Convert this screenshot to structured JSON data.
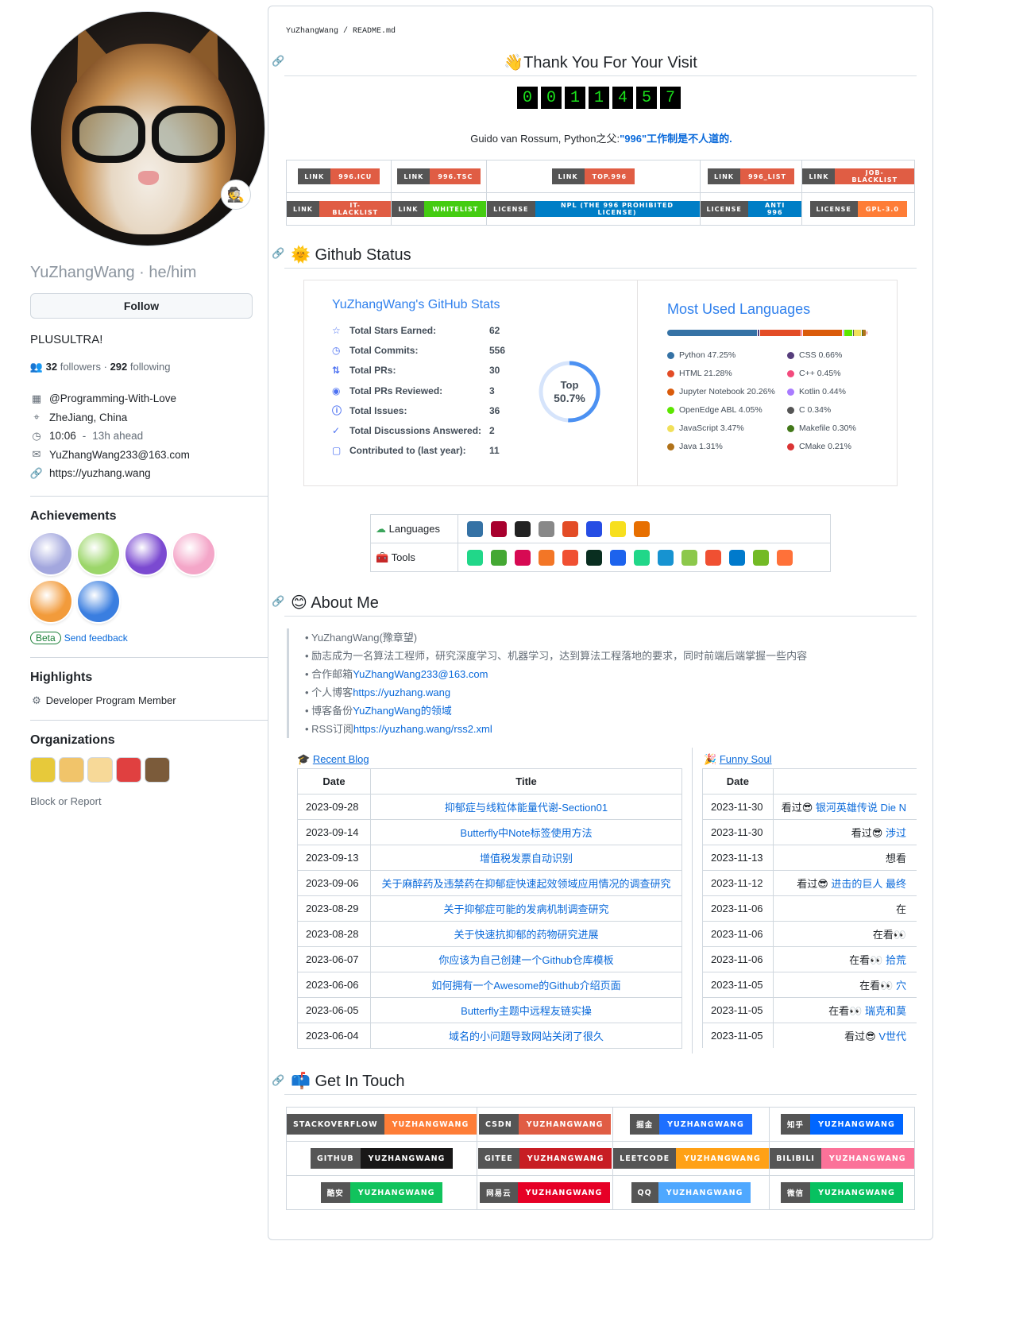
{
  "profile": {
    "username": "YuZhangWang",
    "pronouns": "he/him",
    "follow_label": "Follow",
    "bio": "PLUSULTRA!",
    "followers": "32",
    "followers_label": "followers",
    "following": "292",
    "following_label": "following",
    "status_emoji": "🕵️",
    "org": "@Programming-With-Love",
    "location": "ZheJiang, China",
    "time": "10:06",
    "time_offset": "13h ahead",
    "email": "YuZhangWang233@163.com",
    "website": "https://yuzhang.wang"
  },
  "achievements": {
    "title": "Achievements",
    "beta": "Beta",
    "feedback": "Send feedback",
    "colors": [
      "#a3a7de",
      "#9cd66a",
      "#7b4ad1",
      "#f4a6c8",
      "#f29b3b",
      "#3a7ee0"
    ]
  },
  "highlights": {
    "title": "Highlights",
    "item": "Developer Program Member"
  },
  "organizations": {
    "title": "Organizations",
    "block": "Block or Report",
    "colors": [
      "#e7c93a",
      "#f1c46a",
      "#f7d998",
      "#e04040",
      "#7b5b3a"
    ]
  },
  "readme": {
    "path_user": "YuZhangWang",
    "path_sep": " / ",
    "path_file": "README",
    "path_ext": ".md",
    "title_emoji": "👋",
    "title": "Thank You For Your Visit",
    "counter": [
      "0",
      "0",
      "1",
      "1",
      "4",
      "5",
      "7"
    ],
    "quote_prefix": "Guido van Rossum, Python之父:",
    "quote_link": "\"996\"工作制是不人道的."
  },
  "badges_row1": [
    {
      "l": "LINK",
      "r": "996.ICU",
      "c": "#e05d44"
    },
    {
      "l": "LINK",
      "r": "996.TSC",
      "c": "#e05d44"
    },
    {
      "l": "LINK",
      "r": "TOP.996",
      "c": "#e05d44"
    },
    {
      "l": "LINK",
      "r": "996_LIST",
      "c": "#e05d44"
    },
    {
      "l": "LINK",
      "r": "JOB-BLACKLIST",
      "c": "#e05d44"
    }
  ],
  "badges_row2": [
    {
      "l": "LINK",
      "r": "IT-BLACKLIST",
      "c": "#e05d44"
    },
    {
      "l": "LINK",
      "r": "WHITELIST",
      "c": "#4c1"
    },
    {
      "l": "LICENSE",
      "r": "NPL (THE 996 PROHIBITED LICENSE)",
      "c": "#007ec6"
    },
    {
      "l": "LICENSE",
      "r": "ANTI 996",
      "c": "#007ec6"
    },
    {
      "l": "LICENSE",
      "r": "GPL-3.0",
      "c": "#fe7d37"
    }
  ],
  "github_status": {
    "emoji": "🌞",
    "title": "Github Status"
  },
  "stats": {
    "title": "YuZhangWang's GitHub Stats",
    "rank_top": "Top",
    "rank_val": "50.7%",
    "rank_fraction": 0.507,
    "rows": [
      {
        "icon": "☆",
        "label": "Total Stars Earned:",
        "value": "62"
      },
      {
        "icon": "◷",
        "label": "Total Commits:",
        "value": "556"
      },
      {
        "icon": "⇅",
        "label": "Total PRs:",
        "value": "30"
      },
      {
        "icon": "◉",
        "label": "Total PRs Reviewed:",
        "value": "3"
      },
      {
        "icon": "ⓘ",
        "label": "Total Issues:",
        "value": "36"
      },
      {
        "icon": "✓",
        "label": "Total Discussions Answered:",
        "value": "2"
      },
      {
        "icon": "▢",
        "label": "Contributed to (last year):",
        "value": "11"
      }
    ]
  },
  "languages": {
    "title": "Most Used Languages",
    "items": [
      {
        "name": "Python 47.25%",
        "pct": 47.25,
        "color": "#3572A5"
      },
      {
        "name": "CSS 0.66%",
        "pct": 0.66,
        "color": "#563d7c"
      },
      {
        "name": "HTML 21.28%",
        "pct": 21.28,
        "color": "#e34c26"
      },
      {
        "name": "C++ 0.45%",
        "pct": 0.45,
        "color": "#f34b7d"
      },
      {
        "name": "Jupyter Notebook 20.26%",
        "pct": 20.26,
        "color": "#DA5B0B"
      },
      {
        "name": "Kotlin 0.44%",
        "pct": 0.44,
        "color": "#A97BFF"
      },
      {
        "name": "OpenEdge ABL 4.05%",
        "pct": 4.05,
        "color": "#5ce600"
      },
      {
        "name": "C 0.34%",
        "pct": 0.34,
        "color": "#555555"
      },
      {
        "name": "JavaScript 3.47%",
        "pct": 3.47,
        "color": "#f1e05a"
      },
      {
        "name": "Makefile 0.30%",
        "pct": 0.3,
        "color": "#427819"
      },
      {
        "name": "Java 1.31%",
        "pct": 1.31,
        "color": "#b07219"
      },
      {
        "name": "CMake 0.21%",
        "pct": 0.21,
        "color": "#DA3434"
      }
    ]
  },
  "tools": {
    "languages_label": "Languages",
    "tools_label": "Tools",
    "lang_icons": [
      "python-icon",
      "c-icon",
      "markdown-icon",
      "latex-icon",
      "html5-icon",
      "css3-icon",
      "javascript-icon",
      "java-icon"
    ],
    "lang_colors": [
      "#3572A5",
      "#a8002e",
      "#222",
      "#888",
      "#e34c26",
      "#264de4",
      "#f7df1e",
      "#e76f00"
    ],
    "tool_icons": [
      "pycharm-icon",
      "anaconda-icon",
      "debian-icon",
      "jupyter-icon",
      "git-icon",
      "django-icon",
      "docker-icon",
      "clion-icon",
      "arch-icon",
      "nodejs-icon",
      "git-scm-icon",
      "vscode-icon",
      "opensuse-icon",
      "firefox-icon"
    ],
    "tool_colors": [
      "#21d789",
      "#44a833",
      "#d70a53",
      "#f37626",
      "#f05032",
      "#092e20",
      "#1d63ed",
      "#21d789",
      "#1793d1",
      "#8cc84b",
      "#f05032",
      "#007acc",
      "#73ba25",
      "#ff7139"
    ]
  },
  "about": {
    "emoji": "😊",
    "title": "About Me",
    "items": [
      {
        "text": "YuZhangWang(豫章望)",
        "link": ""
      },
      {
        "text": "励志成为一名算法工程师，研究深度学习、机器学习，达到算法工程落地的要求，同时前端后端掌握一些内容",
        "link": ""
      },
      {
        "text": "合作邮箱",
        "link": "YuZhangWang233@163.com"
      },
      {
        "text": "个人博客",
        "link": "https://yuzhang.wang"
      },
      {
        "text": "博客备份",
        "link": "YuZhangWang的领域"
      },
      {
        "text": "RSS订阅",
        "link": "https://yuzhang.wang/rss2.xml"
      }
    ]
  },
  "blog": {
    "caption_emoji": "🎓",
    "caption": "Recent Blog",
    "col_date": "Date",
    "col_title": "Title",
    "rows": [
      [
        "2023-09-28",
        "抑郁症与线粒体能量代谢-Section01"
      ],
      [
        "2023-09-14",
        "Butterfly中Note标签使用方法"
      ],
      [
        "2023-09-13",
        "增值税发票自动识别"
      ],
      [
        "2023-09-06",
        "关于麻醉药及违禁药在抑郁症快速起效领域应用情况的调查研究"
      ],
      [
        "2023-08-29",
        "关于抑郁症可能的发病机制调查研究"
      ],
      [
        "2023-08-28",
        "关于快速抗抑郁的药物研究进展"
      ],
      [
        "2023-06-07",
        "你应该为自己创建一个Github仓库模板"
      ],
      [
        "2023-06-06",
        "如何拥有一个Awesome的Github介绍页面"
      ],
      [
        "2023-06-05",
        "Butterfly主题中远程友链实操"
      ],
      [
        "2023-06-04",
        "域名的小问题导致网站关闭了很久"
      ]
    ]
  },
  "soul": {
    "caption_emoji": "🎉",
    "caption": "Funny Soul",
    "col_date": "Date",
    "rows": [
      [
        "2023-11-30",
        "看过😎",
        "银河英雄传说 Die N"
      ],
      [
        "2023-11-30",
        "看过😎",
        "涉过"
      ],
      [
        "2023-11-13",
        "想看",
        ""
      ],
      [
        "2023-11-12",
        "看过😎",
        "进击的巨人 最终"
      ],
      [
        "2023-11-06",
        "在",
        ""
      ],
      [
        "2023-11-06",
        "在看👀",
        ""
      ],
      [
        "2023-11-06",
        "在看👀",
        "拾荒"
      ],
      [
        "2023-11-05",
        "在看👀",
        "穴"
      ],
      [
        "2023-11-05",
        "在看👀",
        "瑞克和莫"
      ],
      [
        "2023-11-05",
        "看过😎",
        "V世代"
      ]
    ]
  },
  "contact": {
    "emoji": "📫",
    "title": "Get In Touch",
    "rows": [
      [
        {
          "l": "STACKOVERFLOW",
          "r": "YUZHANGWANG",
          "c": "#fe7d37"
        },
        {
          "l": "CSDN",
          "r": "YUZHANGWANG",
          "c": "#e05d44"
        },
        {
          "l": "掘金",
          "r": "YUZHANGWANG",
          "c": "#1e6fff"
        },
        {
          "l": "知乎",
          "r": "YUZHANGWANG",
          "c": "#0066ff"
        }
      ],
      [
        {
          "l": "GITHUB",
          "r": "YUZHANGWANG",
          "c": "#181717"
        },
        {
          "l": "GITEE",
          "r": "YUZHANGWANG",
          "c": "#c71d23"
        },
        {
          "l": "LEETCODE",
          "r": "YUZHANGWANG",
          "c": "#ffa116"
        },
        {
          "l": "BILIBILI",
          "r": "YUZHANGWANG",
          "c": "#fb7299"
        }
      ],
      [
        {
          "l": "酷安",
          "r": "YUZHANGWANG",
          "c": "#11c35d"
        },
        {
          "l": "网易云",
          "r": "YUZHANGWANG",
          "c": "#e60026"
        },
        {
          "l": "QQ",
          "r": "YUZHANGWANG",
          "c": "#4fa8ff"
        },
        {
          "l": "微信",
          "r": "YUZHANGWANG",
          "c": "#07c160"
        }
      ]
    ]
  }
}
